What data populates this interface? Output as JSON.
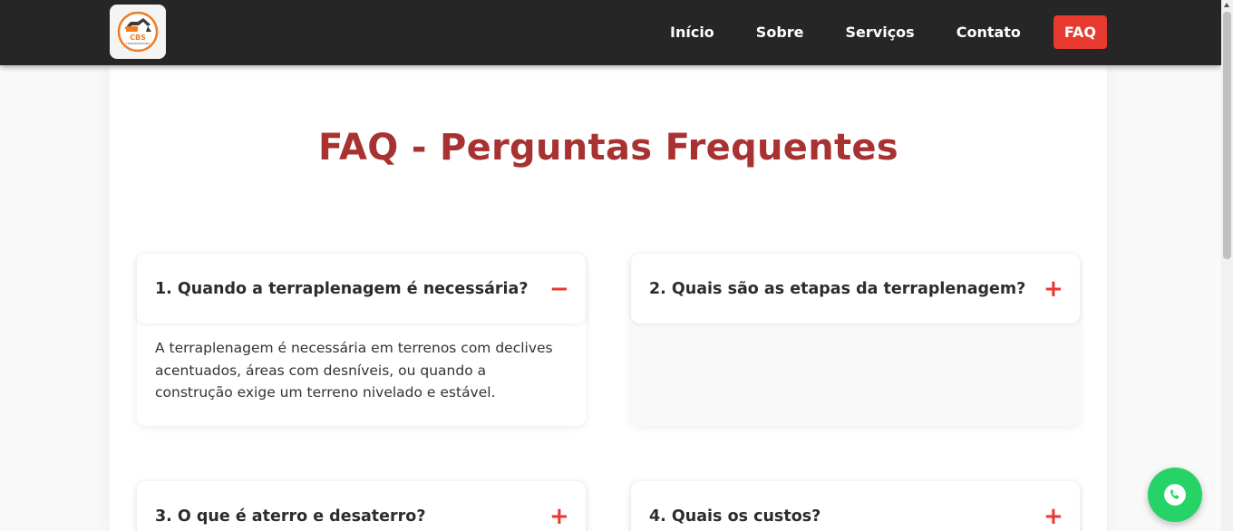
{
  "logo": {
    "text": "CBS",
    "sub": "TERRAPLENAGEM"
  },
  "nav": {
    "items": [
      {
        "label": "Início"
      },
      {
        "label": "Sobre"
      },
      {
        "label": "Serviços"
      },
      {
        "label": "Contato"
      },
      {
        "label": "FAQ",
        "active": true
      }
    ]
  },
  "page": {
    "title": "FAQ - Perguntas Frequentes"
  },
  "faq": [
    {
      "question": "1. Quando a terraplenagem é necessária?",
      "toggle": "−",
      "expanded": true,
      "answer": "A terraplenagem é necessária em terrenos com declives acentuados, áreas com desníveis, ou quando a construção exige um terreno nivelado e estável."
    },
    {
      "question": "2. Quais são as etapas da terraplenagem?",
      "toggle": "+",
      "expanded": false,
      "answer": ""
    },
    {
      "question": "3. O que é aterro e desaterro?",
      "toggle": "+",
      "expanded": false,
      "answer": ""
    },
    {
      "question": "4. Quais os custos?",
      "toggle": "+",
      "expanded": false,
      "answer": ""
    }
  ],
  "colors": {
    "navbar": "#262626",
    "accent": "#e8392f",
    "title": "#a83232",
    "whatsapp": "#25d366"
  },
  "icons": {
    "logo": "excavator-logo-icon",
    "whatsapp": "whatsapp-phone-icon",
    "collapse": "minus-icon",
    "expand": "plus-icon"
  }
}
